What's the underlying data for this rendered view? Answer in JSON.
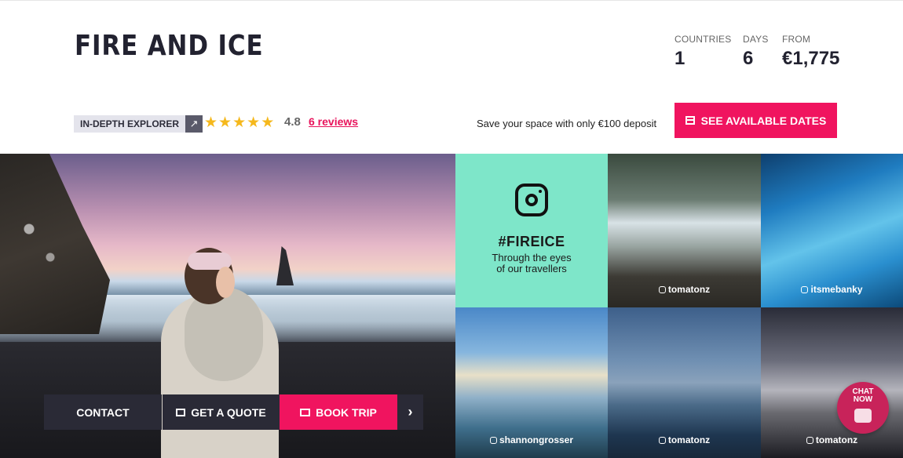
{
  "header": {
    "title": "FIRE AND ICE",
    "stats": [
      {
        "label": "COUNTRIES",
        "value": "1"
      },
      {
        "label": "DAYS",
        "value": "6"
      },
      {
        "label": "FROM",
        "value": "€1,775"
      }
    ]
  },
  "meta": {
    "tag_label": "IN-DEPTH EXPLORER",
    "tag_icon": "external-arrow-icon",
    "stars": 5,
    "rating": "4.8",
    "reviews_link": "6 reviews",
    "deposit_text": "Save your space with only €100 deposit",
    "dates_button": "SEE AVAILABLE DATES",
    "accent_color": "#f0145f"
  },
  "actions": {
    "contact": "CONTACT",
    "quote": "GET A QUOTE",
    "book": "BOOK TRIP",
    "next_icon": "chevron-right-icon"
  },
  "instagram": {
    "hashtag": "#FIREICE",
    "subtitle_line1": "Through the eyes",
    "subtitle_line2": "of our travellers",
    "tile_color": "#7ee6c9",
    "photos": [
      {
        "handle": "tomatonz"
      },
      {
        "handle": "itsmebanky"
      },
      {
        "handle": "shannongrosser"
      },
      {
        "handle": "tomatonz"
      },
      {
        "handle": "tomatonz"
      }
    ]
  },
  "chat": {
    "line1": "CHAT",
    "line2": "NOW"
  }
}
